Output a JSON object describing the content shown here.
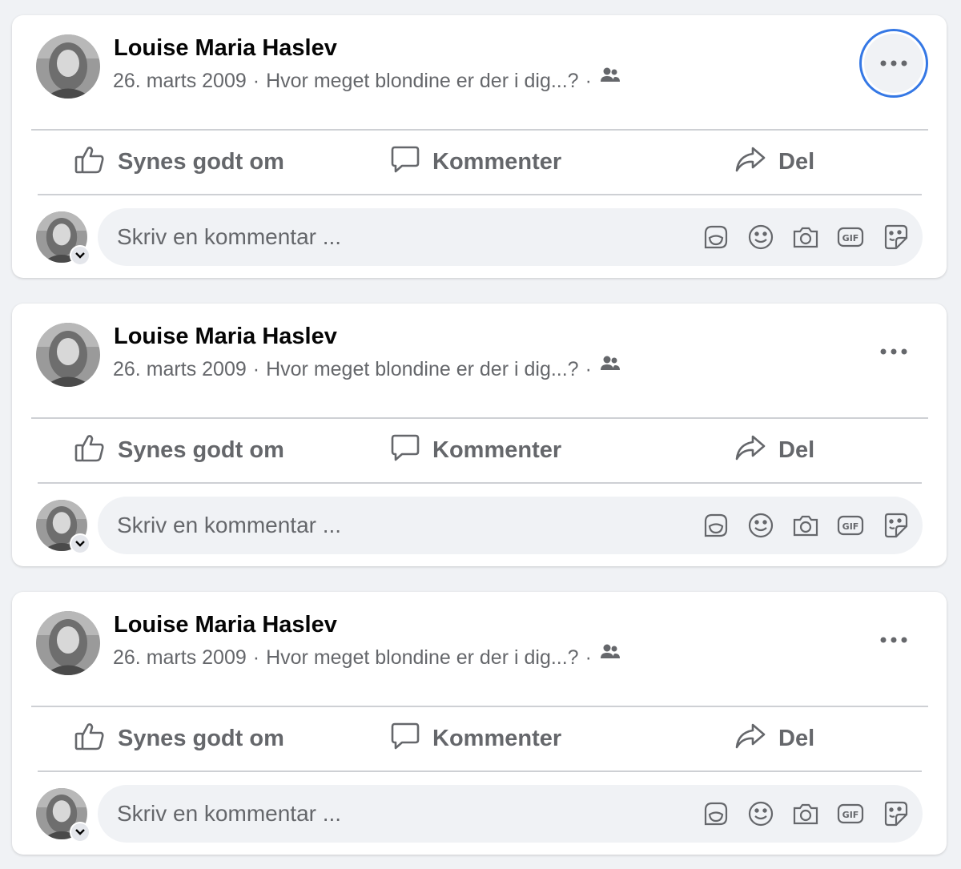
{
  "posts": [
    {
      "author": "Louise Maria Haslev",
      "date": "26. marts 2009",
      "separator": "·",
      "album": "Hvor meget blondine er der i dig...?",
      "audience_icon": "friends-icon",
      "more_focused": true,
      "actions": {
        "like": "Synes godt om",
        "comment": "Kommenter",
        "share": "Del"
      },
      "comment_placeholder": "Skriv en kommentar ..."
    },
    {
      "author": "Louise Maria Haslev",
      "date": "26. marts 2009",
      "separator": "·",
      "album": "Hvor meget blondine er der i dig...?",
      "audience_icon": "friends-icon",
      "more_focused": false,
      "actions": {
        "like": "Synes godt om",
        "comment": "Kommenter",
        "share": "Del"
      },
      "comment_placeholder": "Skriv en kommentar ..."
    },
    {
      "author": "Louise Maria Haslev",
      "date": "26. marts 2009",
      "separator": "·",
      "album": "Hvor meget blondine er der i dig...?",
      "audience_icon": "friends-icon",
      "more_focused": false,
      "actions": {
        "like": "Synes godt om",
        "comment": "Kommenter",
        "share": "Del"
      },
      "comment_placeholder": "Skriv en kommentar ..."
    }
  ],
  "comment_tools": [
    "avatar-sticker-icon",
    "emoji-icon",
    "camera-icon",
    "gif-icon",
    "sticker-icon"
  ],
  "colors": {
    "background": "#f0f2f5",
    "card": "#ffffff",
    "text_primary": "#050505",
    "text_secondary": "#65676b",
    "focus_ring": "#3578e5",
    "divider": "#ced0d4"
  }
}
